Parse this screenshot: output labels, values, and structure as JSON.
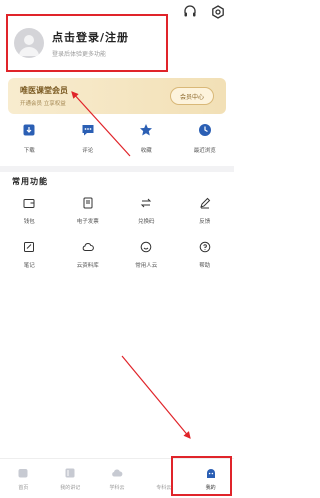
{
  "colors": {
    "accent": "#2b5fb4",
    "annotation": "#e0242a",
    "vip_bg": "#f4e6c2"
  },
  "topbar": {
    "icons": [
      "headset-icon",
      "settings-icon"
    ]
  },
  "profile": {
    "login_label": "点击登录/注册",
    "sub_label": "登录后体验更多功能"
  },
  "vip": {
    "title": "唯医课堂会员",
    "sub": "开通会员 立享权益",
    "button": "会员中心"
  },
  "quick": [
    {
      "label": "下载",
      "icon": "download-icon"
    },
    {
      "label": "评论",
      "icon": "comment-icon"
    },
    {
      "label": "收藏",
      "icon": "star-icon"
    },
    {
      "label": "最近浏览",
      "icon": "clock-icon"
    }
  ],
  "section": {
    "title": "常用功能"
  },
  "functions": [
    {
      "label": "钱包",
      "icon": "wallet-icon"
    },
    {
      "label": "电子发票",
      "icon": "invoice-icon"
    },
    {
      "label": "兑换码",
      "icon": "exchange-icon"
    },
    {
      "label": "反馈",
      "icon": "feedback-icon"
    },
    {
      "label": "笔记",
      "icon": "note-icon"
    },
    {
      "label": "云资料库",
      "icon": "cloud-icon"
    },
    {
      "label": "常用人云",
      "icon": "contacts-icon"
    },
    {
      "label": "帮助",
      "icon": "help-icon"
    }
  ],
  "tabs": [
    {
      "label": "首页",
      "icon": "home-icon"
    },
    {
      "label": "我的讲记",
      "icon": "notes-icon"
    },
    {
      "label": "学科云",
      "icon": "cloud-tab-icon"
    },
    {
      "label": "专科云",
      "icon": "specialty-icon"
    },
    {
      "label": "我的",
      "icon": "profile-icon"
    }
  ]
}
